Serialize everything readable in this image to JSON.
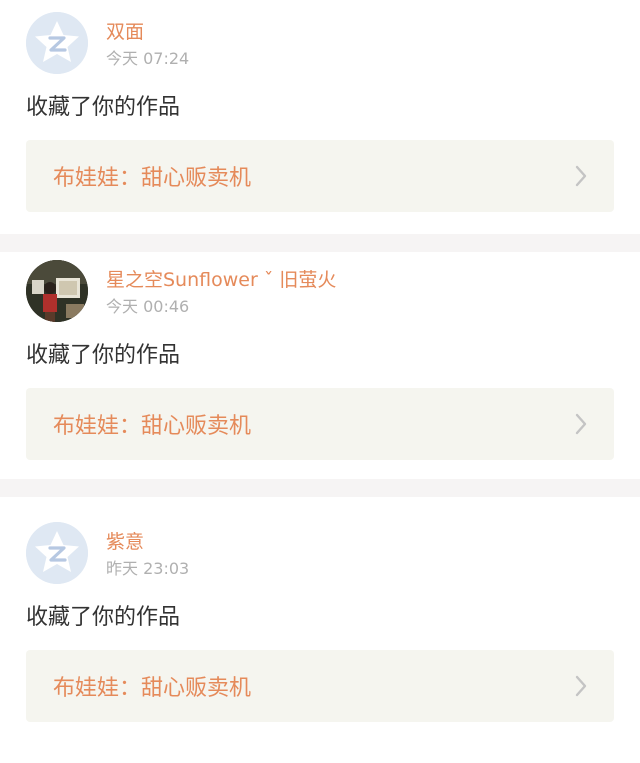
{
  "notifications": [
    {
      "avatar": "default-avatar-icon",
      "name": "双面",
      "time": "今天 07:24",
      "action": "收藏了你的作品",
      "work_title": "布娃娃：甜心贩卖机"
    },
    {
      "avatar": "user-photo-avatar",
      "name": "星之空Sunflower ˇ 旧萤火",
      "time": "今天 00:46",
      "action": "收藏了你的作品",
      "work_title": "布娃娃：甜心贩卖机"
    },
    {
      "avatar": "default-avatar-icon",
      "name": "紫意",
      "time": "昨天 23:03",
      "action": "收藏了你的作品",
      "work_title": "布娃娃：甜心贩卖机"
    }
  ],
  "colors": {
    "accent": "#e58a5a",
    "time": "#b0b0b0",
    "text": "#333333",
    "link_bg": "#f5f5ef",
    "separator": "#f6f4f4",
    "avatar_default": "#dfe8f3"
  }
}
